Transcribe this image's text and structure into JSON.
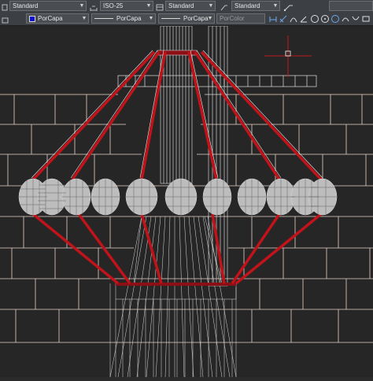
{
  "toolbar": {
    "row1": {
      "text_style": "Standard",
      "dim_style": "ISO-25",
      "table_style": "Standard",
      "mleader_style": "Standard"
    },
    "row2": {
      "color": "PorCapa",
      "linetype": "PorCapa",
      "lineweight": "PorCapa",
      "plotstyle": "PorColor"
    },
    "icons": [
      "dimension-linear-icon",
      "dimension-aligned-icon",
      "dimension-arc-icon",
      "dimension-angular-icon",
      "circle-icon",
      "circle-icon",
      "circle-icon",
      "arc-icon",
      "arc-icon",
      "rectangle-icon"
    ]
  },
  "viewport": {
    "accent_color": "#c0131a",
    "line_color": "#e8e8e8",
    "crosshair_color": "#c21a1a"
  }
}
